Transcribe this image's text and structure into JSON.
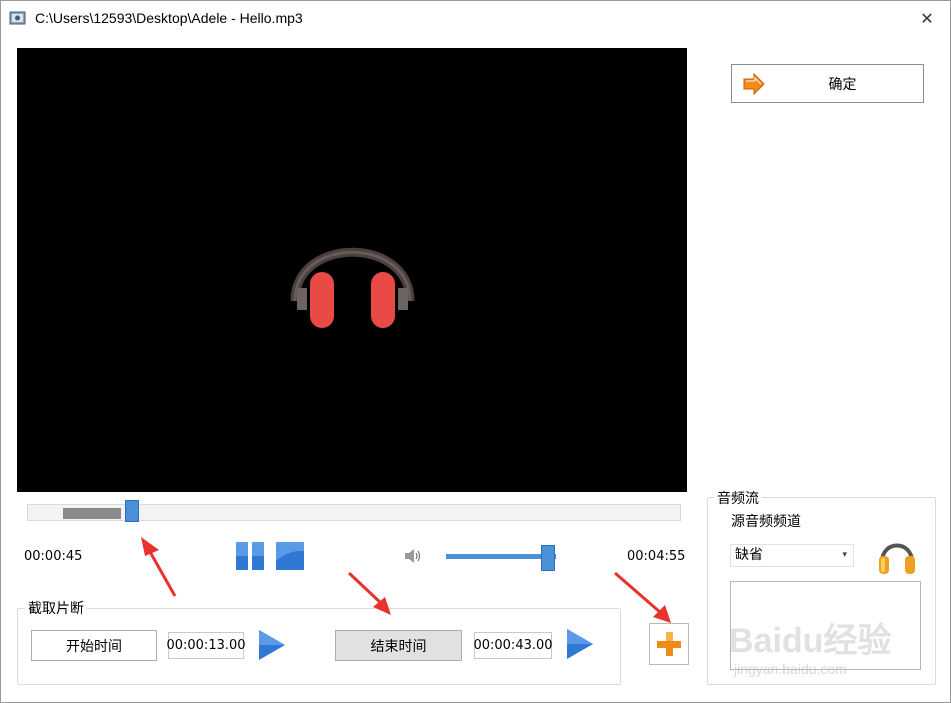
{
  "window": {
    "title": "C:\\Users\\12593\\Desktop\\Adele - Hello.mp3",
    "close_glyph": "✕"
  },
  "actions": {
    "ok_label": "确定"
  },
  "player": {
    "current_time": "00:00:45",
    "total_time": "00:04:55",
    "seek_position_fraction": 0.159,
    "buffer_start_fraction": 0.054,
    "buffer_end_fraction": 0.143,
    "volume_fraction": 0.93
  },
  "clip": {
    "group_label": "截取片断",
    "start_button": "开始时间",
    "start_value": "00:00:13.00",
    "end_button": "结束时间",
    "end_value": "00:00:43.00"
  },
  "audio": {
    "group_label": "音频流",
    "source_label": "源音频频道",
    "selected_option": "缺省",
    "select_arrow": "▾"
  },
  "watermark": {
    "main": "Baidu经验",
    "sub": "jingyan.baidu.com"
  },
  "colors": {
    "accent_blue": "#4a90d9",
    "arrow_red": "#e8322b",
    "headphone_red": "#ea4a46",
    "video_bg": "#000000"
  },
  "icons": [
    "app-icon",
    "close-icon",
    "headphones-icon",
    "ok-arrow-icon",
    "pause-icon",
    "stop-icon",
    "speaker-icon",
    "play-icon",
    "add-plus-icon",
    "audio-headphones-icon"
  ]
}
